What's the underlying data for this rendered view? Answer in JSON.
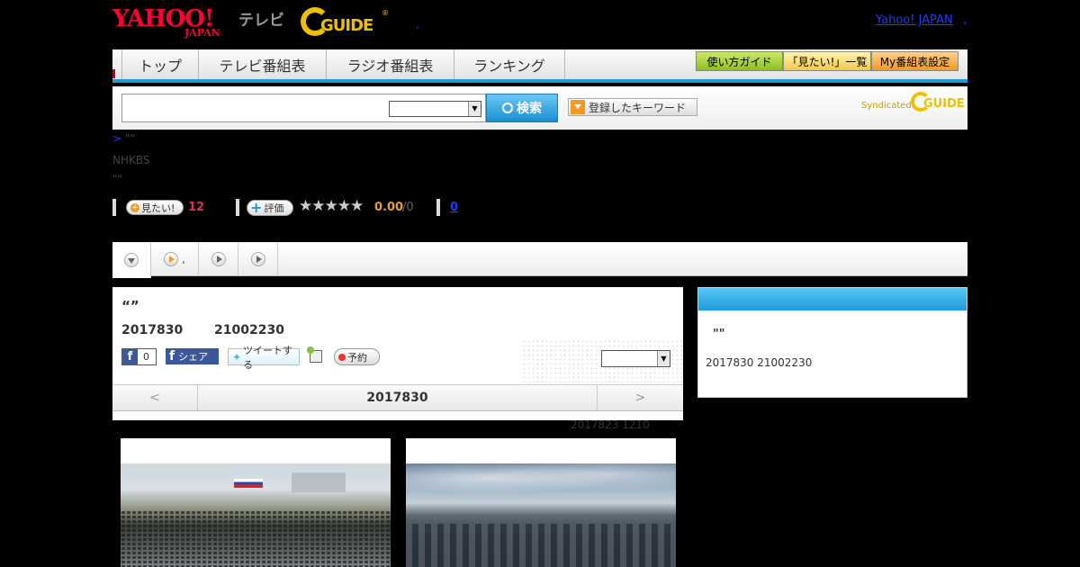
{
  "header": {
    "yahoo_logo_text": "YAHOO!",
    "yahoo_logo_sub": "JAPAN",
    "tv_label": "テレビ",
    "gguide_logo_text": "GUIDE",
    "dot": ",",
    "yahoo_japan_link": "Yahoo! JAPAN",
    "yahoo_japan_link_suffix": ","
  },
  "nav": {
    "tabs": [
      {
        "label": "トップ"
      },
      {
        "label": "テレビ番組表"
      },
      {
        "label": "ラジオ番組表"
      },
      {
        "label": "ランキング"
      }
    ],
    "pills": [
      {
        "label": "使い方ガイド",
        "color": "#8cbf1f"
      },
      {
        "label": "「見たい!」一覧",
        "color": "#f4c84a"
      },
      {
        "label": "My番組表設定",
        "color": "#f29a24"
      }
    ]
  },
  "search": {
    "input_value": "",
    "select_value": "",
    "button_label": "検索",
    "keyword_button_label": "登録したキーワード",
    "syndicated_label": "Syndicated",
    "syndicated_logo": "GUIDE"
  },
  "breadcrumb": {
    "line1_prefix": ">",
    "line1_text": "\"\"",
    "line2": "NHKBS",
    "line3": "\"\""
  },
  "stats": {
    "mitai_label": "見たい!",
    "mitai_count": "12",
    "hyoka_label": "評価",
    "stars": "★★★★★",
    "rating": "0.00",
    "rating_total": "/0",
    "review_count": "0"
  },
  "subtabs": [
    {
      "icon": "down",
      "label": ""
    },
    {
      "icon": "play-orange",
      "label": ","
    },
    {
      "icon": "play",
      "label": ""
    },
    {
      "icon": "play",
      "label": ""
    }
  ],
  "program": {
    "title": "“”",
    "date": "2017830",
    "time": "21002230",
    "fb_like_count": "0",
    "fb_share_label": "シェア",
    "tweet_label": "ツイートする",
    "reserve_label": "予約",
    "select_value": "",
    "date_nav": {
      "prev": "<",
      "current": "2017830",
      "next": ">"
    }
  },
  "updated": "2017823  1210",
  "side": {
    "title": "\"\"",
    "date": "2017830  21002230"
  },
  "colors": {
    "accent_blue": "#1e9bd8",
    "yahoo_red": "#ff0033",
    "gguide_yellow": "#f0c000",
    "count_pink": "#e0305a",
    "rating_orange": "#e0a040"
  }
}
